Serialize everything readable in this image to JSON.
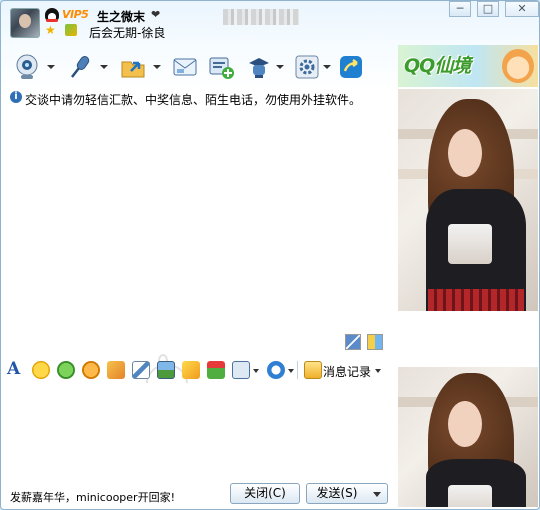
{
  "window": {
    "controls": {
      "minimize": "─",
      "maximize": "□",
      "close": "✕"
    }
  },
  "header": {
    "vip_badge": "VIP5",
    "nickname": "生之微末",
    "heart": "❤",
    "signature": "后会无期-徐良",
    "avatar_icon": "user-avatar",
    "status_icon": "qq-penguin-icon"
  },
  "toolbar": {
    "items": [
      {
        "name": "video-call",
        "icon": "webcam-icon"
      },
      {
        "name": "voice-call",
        "icon": "microphone-icon"
      },
      {
        "name": "send-file",
        "icon": "folder-send-icon"
      },
      {
        "name": "send-email",
        "icon": "email-icon"
      },
      {
        "name": "create-group",
        "icon": "add-group-icon"
      },
      {
        "name": "remote-assist",
        "icon": "remote-icon"
      },
      {
        "name": "app-manager",
        "icon": "gear-icon"
      },
      {
        "name": "share-screen",
        "icon": "share-icon"
      }
    ]
  },
  "notice": {
    "text": "交谈中请勿轻信汇款、中奖信息、陌生电话，勿使用外挂软件。"
  },
  "input_toolbar": {
    "font_button": "A",
    "history_label": "消息记录"
  },
  "footer": {
    "ad_text": "发薪嘉年华，minicooper开回家!",
    "close_button": "关闭(C)",
    "send_button": "发送(S)"
  },
  "side_panel": {
    "banner_text": "QQ仙境",
    "colors": {
      "banner_green": "#3b9b2b",
      "accent_blue": "#2356a8"
    }
  }
}
